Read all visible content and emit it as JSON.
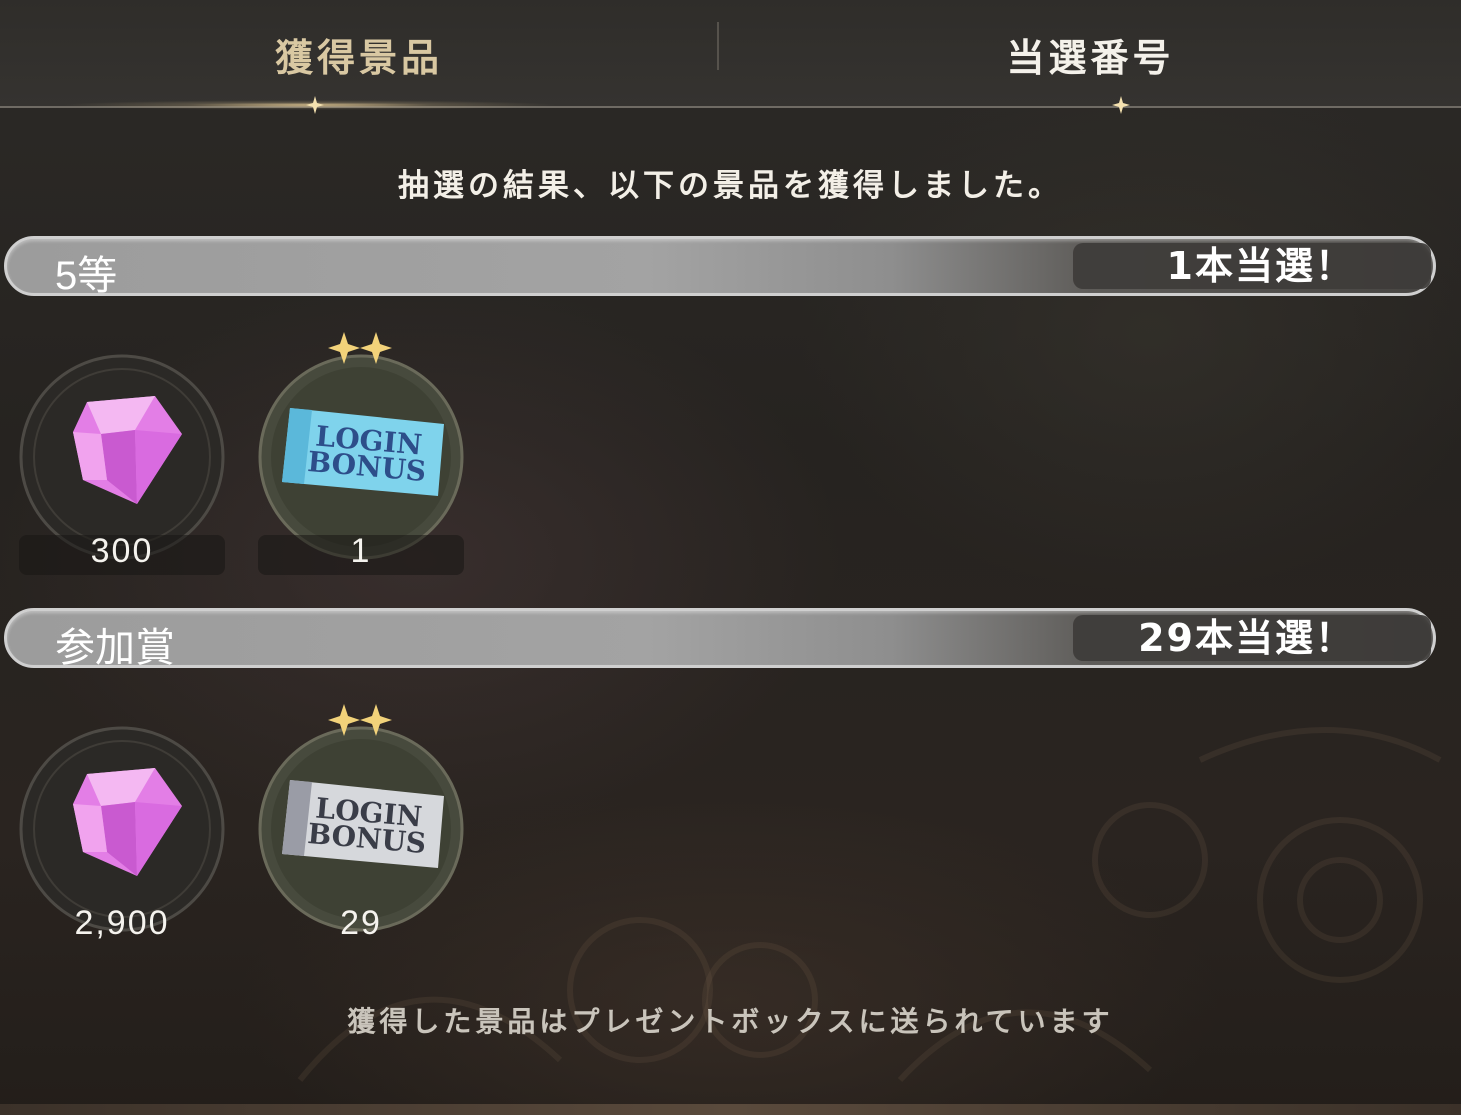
{
  "tabs": [
    {
      "label": "獲得景品",
      "active": true
    },
    {
      "label": "当選番号",
      "active": false
    }
  ],
  "intro_text": "抽選の結果、以下の景品を獲得しました。",
  "sections": [
    {
      "rank": "5等",
      "count_text": "1本当選！",
      "items": [
        {
          "icon": "gem-icon",
          "quantity": "300"
        },
        {
          "icon": "login-bonus-ticket-blue-icon",
          "ticket_text": [
            "LOGIN",
            "BONUS"
          ],
          "quantity": "1"
        }
      ]
    },
    {
      "rank": "参加賞",
      "count_text": "29本当選！",
      "items": [
        {
          "icon": "gem-icon",
          "quantity": "2,900"
        },
        {
          "icon": "login-bonus-ticket-silver-icon",
          "ticket_text": [
            "LOGIN",
            "BONUS"
          ],
          "quantity": "29"
        }
      ]
    }
  ],
  "footer_text": "獲得した景品はプレゼントボックスに送られています",
  "colors": {
    "active_tab": "#d9c8a2",
    "gem": "#e37ee6",
    "ticket_blue": "#7fd3ec",
    "ticket_silver": "#d6d8dc",
    "sparkle": "#f2d27a"
  }
}
